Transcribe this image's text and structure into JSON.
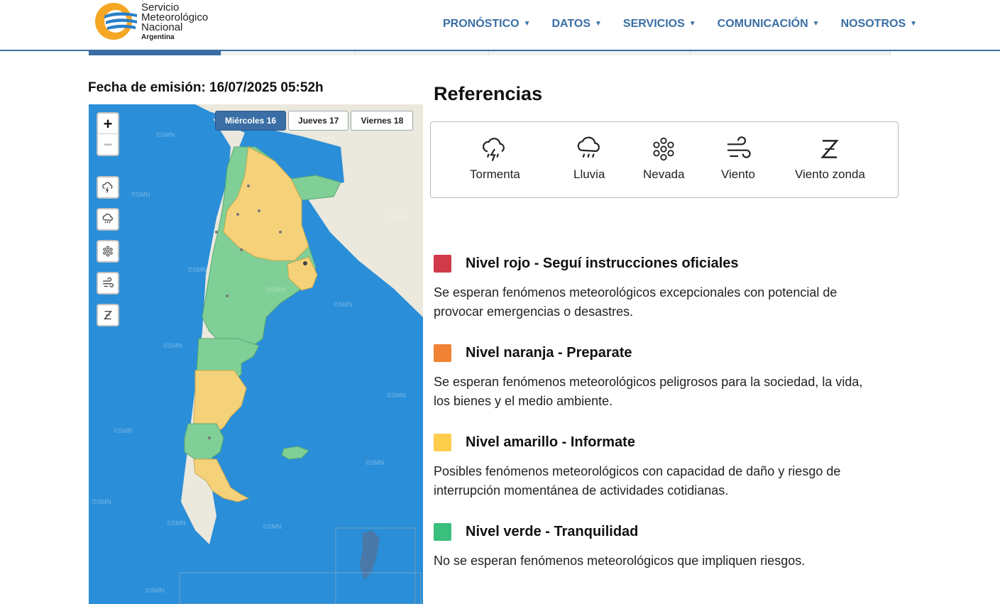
{
  "brand": {
    "line1": "Servicio",
    "line2": "Meteorológico",
    "line3": "Nacional",
    "line4": "Argentina",
    "logo_colors": [
      "#f5a623",
      "#2a7fc9"
    ]
  },
  "nav": {
    "items": [
      {
        "label": "PRONÓSTICO"
      },
      {
        "label": "DATOS"
      },
      {
        "label": "SERVICIOS"
      },
      {
        "label": "COMUNICACIÓN"
      },
      {
        "label": "NOSOTROS"
      }
    ],
    "color": "#3a6ea5"
  },
  "emission": {
    "text": "Fecha de emisión: 16/07/2025 05:52h"
  },
  "map": {
    "day_tabs": [
      {
        "label": "Miércoles 16",
        "active": true
      },
      {
        "label": "Jueves 17",
        "active": false
      },
      {
        "label": "Viernes 18",
        "active": false
      }
    ],
    "zoom_in": "+",
    "zoom_out": "−",
    "layer_buttons": [
      "storm-icon",
      "rain-icon",
      "snow-icon",
      "wind-icon",
      "zonda-icon"
    ],
    "watermark": "©SMN",
    "colors": {
      "sea": "#2a8ed8",
      "land": "#ebe8dd",
      "green": "#7fcf96",
      "yellow": "#f5d27a"
    }
  },
  "references": {
    "title": "Referencias",
    "items": [
      {
        "icon": "storm-icon",
        "label": "Tormenta"
      },
      {
        "icon": "rain-icon",
        "label": "Lluvia"
      },
      {
        "icon": "snow-icon",
        "label": "Nevada"
      },
      {
        "icon": "wind-icon",
        "label": "Viento"
      },
      {
        "icon": "zonda-icon",
        "label": "Viento zonda"
      }
    ]
  },
  "levels": [
    {
      "name": "Nivel rojo - Seguí instrucciones oficiales",
      "color": "#d13a4a",
      "desc": "Se esperan fenómenos meteorológicos excepcionales con potencial de provocar emergencias o desastres."
    },
    {
      "name": "Nivel naranja - Preparate",
      "color": "#ef8233",
      "desc": "Se esperan fenómenos meteorológicos peligrosos para la sociedad, la vida, los bienes y el medio ambiente."
    },
    {
      "name": "Nivel amarillo - Informate",
      "color": "#fdcd4c",
      "desc": "Posibles fenómenos meteorológicos con capacidad de daño y riesgo de interrupción momentánea de actividades cotidianas."
    },
    {
      "name": "Nivel verde - Tranquilidad",
      "color": "#3bbf7c",
      "desc": "No se esperan fenómenos meteorológicos que impliquen riesgos."
    }
  ]
}
